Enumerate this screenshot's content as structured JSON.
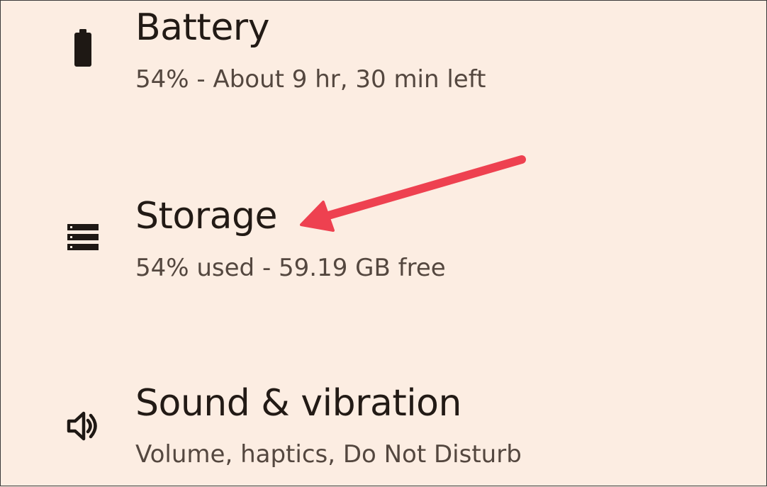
{
  "settings": {
    "items": [
      {
        "title": "Battery",
        "summary": "54% - About 9 hr, 30 min left",
        "icon": "battery-icon"
      },
      {
        "title": "Storage",
        "summary": "54% used - 59.19 GB free",
        "icon": "storage-icon"
      },
      {
        "title": "Sound & vibration",
        "summary": "Volume, haptics, Do Not Disturb",
        "icon": "volume-icon"
      }
    ]
  },
  "annotation": {
    "arrow_color": "#ee4150",
    "points_to": "Storage"
  }
}
